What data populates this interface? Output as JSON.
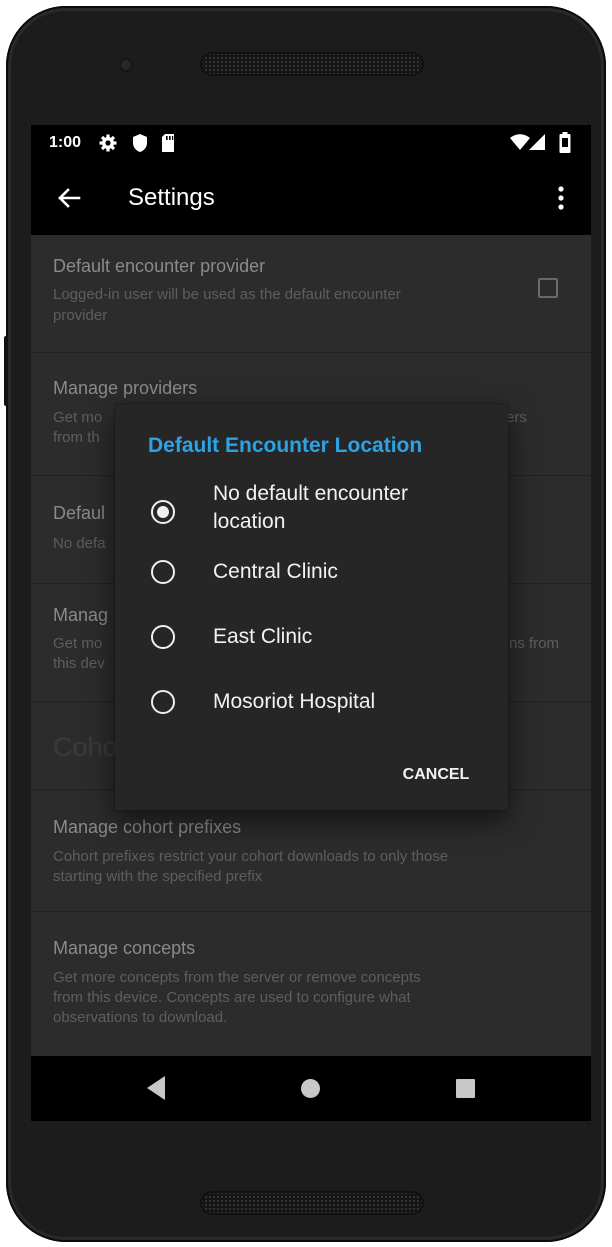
{
  "status_bar": {
    "time": "1:00"
  },
  "app_bar": {
    "title": "Settings"
  },
  "preferences": [
    {
      "title": "Default encounter provider",
      "summary_line1": "Logged-in user will be used as the default encounter",
      "summary_line2": "provider"
    },
    {
      "title": "Manage providers",
      "summary_line1": "Get mo",
      "summary_line1_right": "ers",
      "summary_line2": "from th"
    },
    {
      "title": "Defaul",
      "summary_line1": "No defa"
    },
    {
      "title": "Manag",
      "summary_line1": "Get mo",
      "summary_line1_right": "ns from",
      "summary_line2": "this dev"
    }
  ],
  "section_header": "Coho",
  "preferences_lower": [
    {
      "title": "Manage cohort prefixes",
      "summary_line1": "Cohort prefixes restrict your cohort downloads to only those",
      "summary_line2": "starting with the specified prefix"
    },
    {
      "title": "Manage concepts",
      "summary_line1": "Get more concepts from the server or remove concepts",
      "summary_line2": "from this device. Concepts are used to configure what",
      "summary_line3": "observations to download."
    }
  ],
  "dialog": {
    "title": "Default Encounter Location",
    "options": [
      {
        "label": "No default encounter location",
        "checked": true
      },
      {
        "label": "Central Clinic",
        "checked": false
      },
      {
        "label": "East Clinic",
        "checked": false
      },
      {
        "label": "Mosoriot Hospital",
        "checked": false
      }
    ],
    "cancel_label": "CANCEL"
  },
  "colors": {
    "accent": "#2ea3e3",
    "background": "#2c2c2c",
    "dialog": "#262626"
  }
}
